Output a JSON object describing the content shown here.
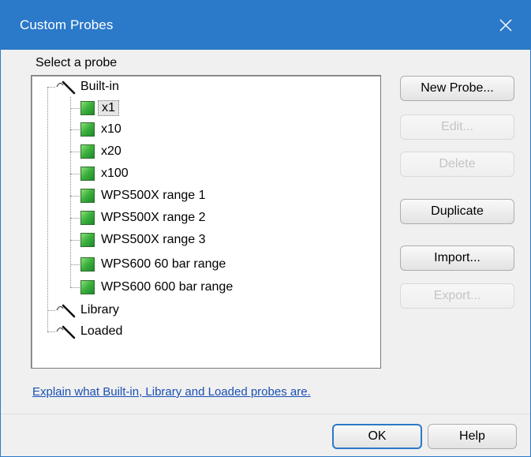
{
  "window": {
    "title": "Custom Probes",
    "close_icon": "close-icon"
  },
  "tree_group": {
    "label": "Select a probe",
    "categories": [
      {
        "label": "Built-in",
        "icon": "probe-folder-icon",
        "children": [
          {
            "label": "x1",
            "icon": "probe-icon",
            "selected": true
          },
          {
            "label": "x10",
            "icon": "probe-icon"
          },
          {
            "label": "x20",
            "icon": "probe-icon"
          },
          {
            "label": "x100",
            "icon": "probe-icon"
          },
          {
            "label": "WPS500X range 1",
            "icon": "probe-icon"
          },
          {
            "label": "WPS500X range 2",
            "icon": "probe-icon"
          },
          {
            "label": "WPS500X range 3",
            "icon": "probe-icon"
          },
          {
            "label": "WPS600 60 bar range",
            "icon": "probe-icon"
          },
          {
            "label": "WPS600 600 bar range",
            "icon": "probe-icon"
          }
        ]
      },
      {
        "label": "Library",
        "icon": "probe-folder-icon",
        "children": []
      },
      {
        "label": "Loaded",
        "icon": "probe-folder-icon",
        "children": []
      }
    ]
  },
  "buttons": {
    "new_probe": {
      "label": "New Probe...",
      "enabled": true
    },
    "edit": {
      "label": "Edit...",
      "enabled": false
    },
    "delete": {
      "label": "Delete",
      "enabled": false
    },
    "duplicate": {
      "label": "Duplicate",
      "enabled": true
    },
    "import": {
      "label": "Import...",
      "enabled": true
    },
    "export": {
      "label": "Export...",
      "enabled": false
    }
  },
  "help_link": {
    "text": "Explain what Built-in, Library and Loaded probes are."
  },
  "footer": {
    "ok_label": "OK",
    "help_label": "Help"
  },
  "colors": {
    "titlebar": "#2b79c9",
    "link": "#1a4fb5",
    "probe_green": "#3fb33f"
  }
}
